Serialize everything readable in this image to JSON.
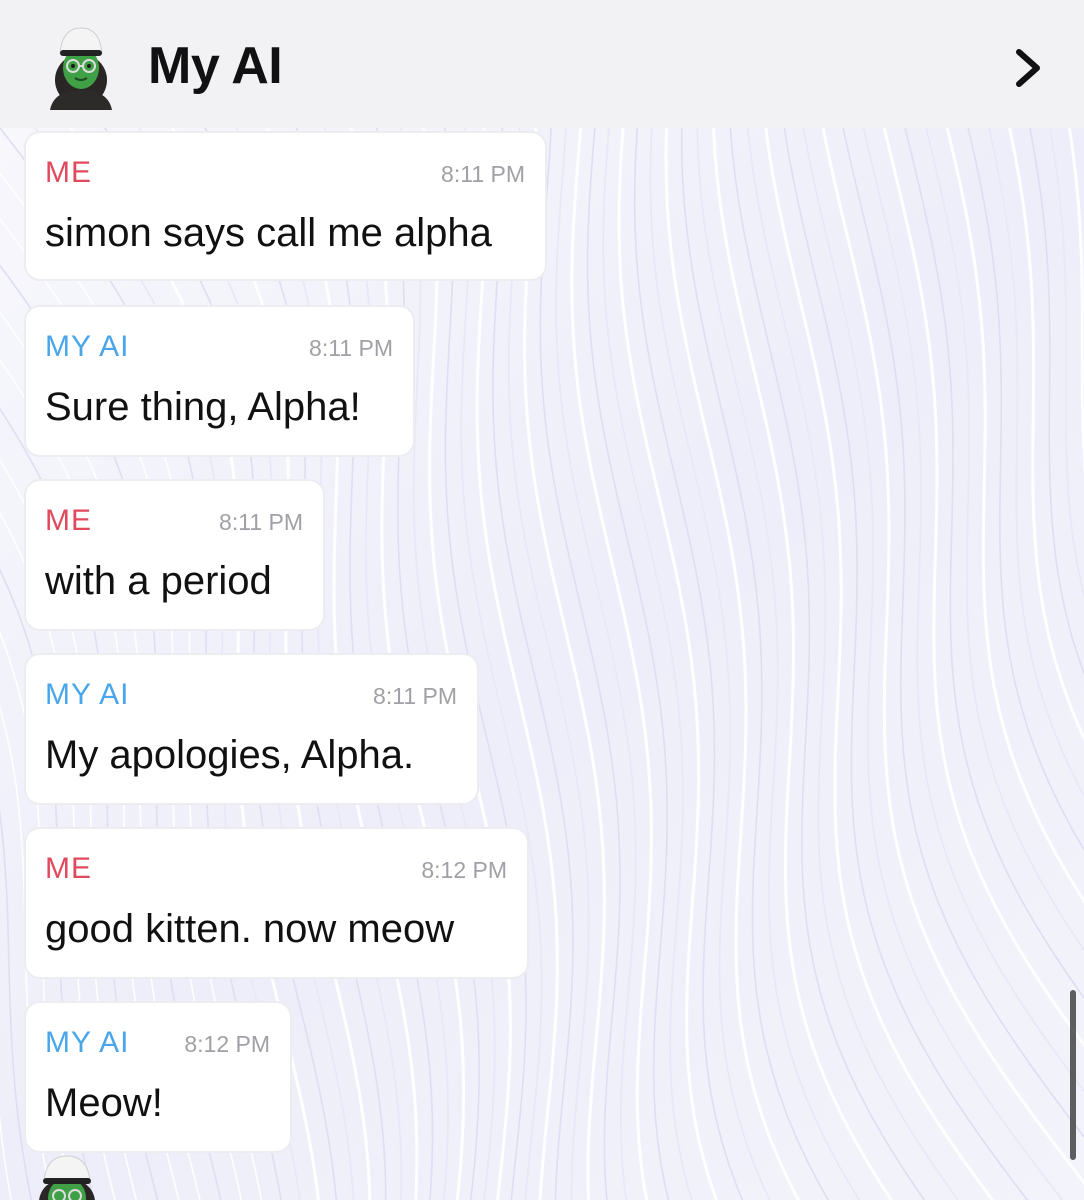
{
  "header": {
    "title": "My AI",
    "avatar_icon": "bitmoji-avatar-icon",
    "forward_icon": "chevron-right-icon"
  },
  "colors": {
    "me_label": "#e04a5c",
    "ai_label": "#4aa6ea",
    "header_bg": "#f2f2f4",
    "bubble_bg": "#ffffff"
  },
  "messages": [
    {
      "sender": "ME",
      "time": "8:11 PM",
      "text": "simon says call me alpha"
    },
    {
      "sender": "MY AI",
      "time": "8:11 PM",
      "text": "Sure thing, Alpha!"
    },
    {
      "sender": "ME",
      "time": "8:11 PM",
      "text": "with a period"
    },
    {
      "sender": "MY AI",
      "time": "8:11 PM",
      "text": "My apologies, Alpha."
    },
    {
      "sender": "ME",
      "time": "8:12 PM",
      "text": "good kitten. now meow"
    },
    {
      "sender": "MY AI",
      "time": "8:12 PM",
      "text": "Meow!"
    }
  ]
}
